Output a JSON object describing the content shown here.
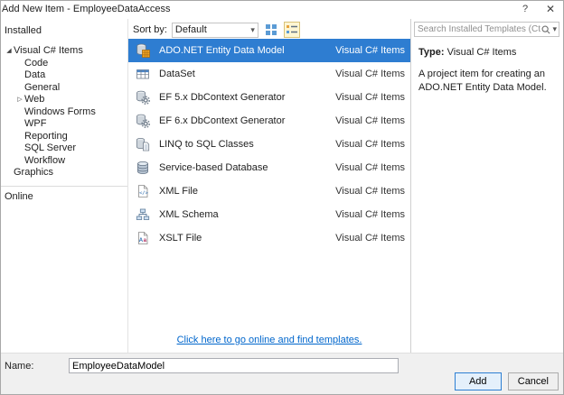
{
  "window": {
    "title": "Add New Item - EmployeeDataAccess",
    "help_glyph": "?",
    "close_glyph": "✕"
  },
  "sidebar": {
    "installed_label": "Installed",
    "online_label": "Online",
    "tree": [
      {
        "label": "Visual C# Items"
      },
      {
        "label": "Code"
      },
      {
        "label": "Data"
      },
      {
        "label": "General"
      },
      {
        "label": "Web"
      },
      {
        "label": "Windows Forms"
      },
      {
        "label": "WPF"
      },
      {
        "label": "Reporting"
      },
      {
        "label": "SQL Server"
      },
      {
        "label": "Workflow"
      },
      {
        "label": "Graphics"
      }
    ]
  },
  "toolbar": {
    "sort_by_label": "Sort by:",
    "sort_value": "Default"
  },
  "search": {
    "placeholder": "Search Installed Templates (Ctrl+E)"
  },
  "templates": [
    {
      "name": "ADO.NET Entity Data Model",
      "type": "Visual C# Items"
    },
    {
      "name": "DataSet",
      "type": "Visual C# Items"
    },
    {
      "name": "EF 5.x DbContext Generator",
      "type": "Visual C# Items"
    },
    {
      "name": "EF 6.x DbContext Generator",
      "type": "Visual C# Items"
    },
    {
      "name": "LINQ to SQL Classes",
      "type": "Visual C# Items"
    },
    {
      "name": "Service-based Database",
      "type": "Visual C# Items"
    },
    {
      "name": "XML File",
      "type": "Visual C# Items"
    },
    {
      "name": "XML Schema",
      "type": "Visual C# Items"
    },
    {
      "name": "XSLT File",
      "type": "Visual C# Items"
    }
  ],
  "list_footer": {
    "online_link": "Click here to go online and find templates."
  },
  "details": {
    "type_label": "Type:",
    "type_value": "Visual C# Items",
    "description": "A project item for creating an ADO.NET Entity Data Model."
  },
  "footer": {
    "name_label": "Name:",
    "name_value": "EmployeeDataModel",
    "add_label": "Add",
    "cancel_label": "Cancel"
  },
  "icons": {
    "expanded_glyph": "◢",
    "collapsed_glyph": "▷",
    "dropdown_caret": "▾"
  },
  "colors": {
    "selection_blue": "#2e7dd1",
    "link_blue": "#0066cc",
    "tree_selection": "#cccedb"
  }
}
